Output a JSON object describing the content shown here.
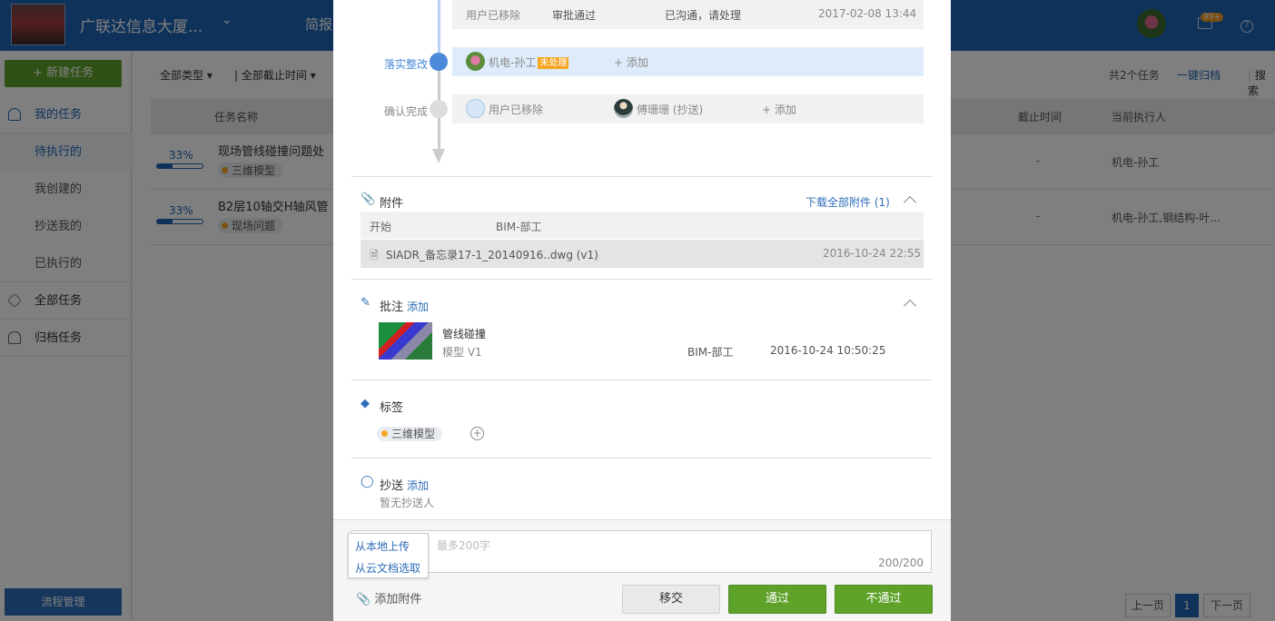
{
  "app": {
    "project_title": "广联达信息大厦...",
    "brief_tab": "简报",
    "notification_badge": "99+",
    "help_symbol": "?"
  },
  "sidebar": {
    "new_task": "新建任务",
    "items": [
      {
        "label": "我的任务"
      },
      {
        "label": "待执行的"
      },
      {
        "label": "我创建的"
      },
      {
        "label": "抄送我的"
      },
      {
        "label": "已执行的"
      },
      {
        "label": "全部任务"
      },
      {
        "label": "归档任务"
      }
    ],
    "flow_manage": "流程管理"
  },
  "toolbar": {
    "filter_type": "全部类型",
    "filter_deadline": "全部截止时间",
    "task_count": "共2个任务",
    "archive_all": "一键归档",
    "search": "搜索"
  },
  "table": {
    "headers": {
      "name": "任务名称",
      "deadline": "截止时间",
      "executor": "当前执行人"
    },
    "rows": [
      {
        "progress": "33%",
        "progress_value": 0.33,
        "name": "现场管线碰撞问题处",
        "tag": "三维模型",
        "deadline": "-",
        "executor": "机电-孙工"
      },
      {
        "progress": "33%",
        "progress_value": 0.33,
        "name": "B2层10轴交H轴风管",
        "tag": "现场问题",
        "deadline": "-",
        "executor": "机电-孙工,钢结构-叶..."
      }
    ]
  },
  "pagination": {
    "prev": "上一页",
    "current": "1",
    "next": "下一页"
  },
  "modal": {
    "flow": {
      "approved_row": {
        "user": "用户已移除",
        "status": "审批通过",
        "comment": "已沟通，请处理",
        "time": "2017-02-08 13:44"
      },
      "steps": [
        {
          "label": "落实整改",
          "user": "机电-孙工",
          "badge": "未处理",
          "add": "+ 添加"
        },
        {
          "label": "确认完成",
          "user": "用户已移除",
          "cc": "傅珊珊 (抄送)",
          "add": "+ 添加"
        }
      ]
    },
    "attachments": {
      "title": "附件",
      "download_all": "下载全部附件 (1)",
      "head_label": "开始",
      "head_user": "BIM-部工",
      "file_name": "SIADR_备忘录17-1_20140916..dwg (v1)",
      "file_time": "2016-10-24 22:55"
    },
    "notes": {
      "title": "批注",
      "add": "添加",
      "item_title": "管线碰撞",
      "item_meta": "模型  V1",
      "item_user": "BIM-部工",
      "item_time": "2016-10-24 10:50:25"
    },
    "tags": {
      "title": "标签",
      "tag": "三维模型",
      "add_symbol": "+"
    },
    "cc": {
      "title": "抄送",
      "add": "添加",
      "empty": "暂无抄送人"
    },
    "footer": {
      "placeholder_visible": "最多200字",
      "char_count": "200/200",
      "upload_local": "从本地上传",
      "upload_cloud": "从云文档选取",
      "add_attachment": "添加附件",
      "transfer": "移交",
      "pass": "通过",
      "reject": "不通过"
    }
  }
}
